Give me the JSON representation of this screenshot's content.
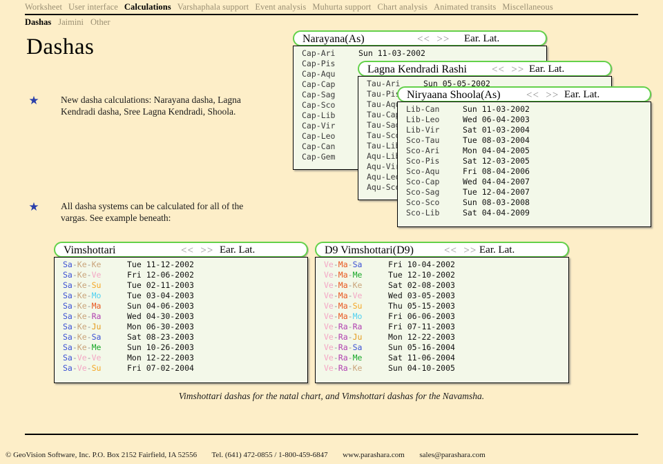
{
  "nav_primary": [
    {
      "label": "Worksheet",
      "active": false
    },
    {
      "label": "User interface",
      "active": false
    },
    {
      "label": "Calculations",
      "active": true
    },
    {
      "label": "Varshaphala support",
      "active": false
    },
    {
      "label": "Event analysis",
      "active": false
    },
    {
      "label": "Muhurta support",
      "active": false
    },
    {
      "label": "Chart analysis",
      "active": false
    },
    {
      "label": "Animated transits",
      "active": false
    },
    {
      "label": "Miscellaneous",
      "active": false
    }
  ],
  "nav_secondary": [
    {
      "label": "Dashas",
      "active": true
    },
    {
      "label": "Jaimini",
      "active": false
    },
    {
      "label": "Other",
      "active": false
    }
  ],
  "page_title": "Dashas",
  "bullets": [
    {
      "text": "New dasha calculations: Narayana dasha, Lagna Kendradi dasha, Sree Lagna Kendradi, Shoola."
    },
    {
      "text": "All dasha systems can be calculated for all of the vargas. See example beneath:"
    }
  ],
  "caption": "Vimshottari dashas for the natal chart, and Vimshottari dashas for the Navamsha.",
  "footer": {
    "copyright": "© GeoVision Software, Inc. P.O. Box 2152 Fairfield, IA 52556",
    "phone": "Tel. (641) 472-0855 / 1-800-459-6847",
    "website": "www.parashara.com",
    "email": "sales@parashara.com"
  },
  "panel_controls": {
    "prev": "<<",
    "next": ">>",
    "earlat": "Ear. Lat."
  },
  "panels": {
    "narayana": {
      "title": "Narayana(As)",
      "rows": [
        {
          "label": "Cap-Ari",
          "date": "Sun  11-03-2002"
        },
        {
          "label": "Cap-Pis",
          "date": ""
        },
        {
          "label": "Cap-Aqu",
          "date": ""
        },
        {
          "label": "Cap-Cap",
          "date": ""
        },
        {
          "label": "Cap-Sag",
          "date": ""
        },
        {
          "label": "Cap-Sco",
          "date": ""
        },
        {
          "label": "Cap-Lib",
          "date": ""
        },
        {
          "label": "Cap-Vir",
          "date": ""
        },
        {
          "label": "Cap-Leo",
          "date": ""
        },
        {
          "label": "Cap-Can",
          "date": ""
        },
        {
          "label": "Cap-Gem",
          "date": ""
        }
      ]
    },
    "lagna_kendradi": {
      "title": "Lagna Kendradi Rashi",
      "rows": [
        {
          "label": "Tau-Ari",
          "date": "Sun  05-05-2002"
        },
        {
          "label": "Tau-Pis",
          "date": ""
        },
        {
          "label": "Tau-Aqu",
          "date": ""
        },
        {
          "label": "Tau-Cap",
          "date": ""
        },
        {
          "label": "Tau-Sag",
          "date": ""
        },
        {
          "label": "Tau-Sco",
          "date": ""
        },
        {
          "label": "Tau-Lib",
          "date": ""
        },
        {
          "label": "Aqu-Lib",
          "date": ""
        },
        {
          "label": "Aqu-Vir",
          "date": ""
        },
        {
          "label": "Aqu-Leo",
          "date": ""
        },
        {
          "label": "Aqu-Sco",
          "date": ""
        }
      ]
    },
    "niryaana_shoola": {
      "title": "Niryaana Shoola(As)",
      "rows": [
        {
          "label": "Lib-Can",
          "date": "Sun  11-03-2002"
        },
        {
          "label": "Lib-Leo",
          "date": "Wed 06-04-2003"
        },
        {
          "label": "Lib-Vir",
          "date": "Sat  01-03-2004"
        },
        {
          "label": "Sco-Tau",
          "date": "Tue  08-03-2004"
        },
        {
          "label": "Sco-Ari",
          "date": "Mon 04-04-2005"
        },
        {
          "label": "Sco-Pis",
          "date": "Sat  12-03-2005"
        },
        {
          "label": "Sco-Aqu",
          "date": "Fri  08-04-2006"
        },
        {
          "label": "Sco-Cap",
          "date": "Wed 04-04-2007"
        },
        {
          "label": "Sco-Sag",
          "date": "Tue  12-04-2007"
        },
        {
          "label": "Sco-Sco",
          "date": "Sun  08-03-2008"
        },
        {
          "label": "Sco-Lib",
          "date": "Sat  04-04-2009"
        }
      ]
    },
    "vimshottari": {
      "title": "Vimshottari",
      "rows": [
        {
          "tokens": [
            "Sa",
            "Ke",
            "Ke"
          ],
          "date": "Tue  11-12-2002"
        },
        {
          "tokens": [
            "Sa",
            "Ke",
            "Ve"
          ],
          "date": "Fri  12-06-2002"
        },
        {
          "tokens": [
            "Sa",
            "Ke",
            "Su"
          ],
          "date": "Tue  02-11-2003"
        },
        {
          "tokens": [
            "Sa",
            "Ke",
            "Mo"
          ],
          "date": "Tue  03-04-2003"
        },
        {
          "tokens": [
            "Sa",
            "Ke",
            "Ma"
          ],
          "date": "Sun  04-06-2003"
        },
        {
          "tokens": [
            "Sa",
            "Ke",
            "Ra"
          ],
          "date": "Wed 04-30-2003"
        },
        {
          "tokens": [
            "Sa",
            "Ke",
            "Ju"
          ],
          "date": "Mon 06-30-2003"
        },
        {
          "tokens": [
            "Sa",
            "Ke",
            "Sa"
          ],
          "date": "Sat  08-23-2003"
        },
        {
          "tokens": [
            "Sa",
            "Ke",
            "Me"
          ],
          "date": "Sun  10-26-2003"
        },
        {
          "tokens": [
            "Sa",
            "Ve",
            "Ve"
          ],
          "date": "Mon 12-22-2003"
        },
        {
          "tokens": [
            "Sa",
            "Ve",
            "Su"
          ],
          "date": "Fri  07-02-2004"
        }
      ]
    },
    "vimshottari_d9": {
      "title": "D9  Vimshottari(D9)",
      "rows": [
        {
          "tokens": [
            "Ve",
            "Ma",
            "Sa"
          ],
          "date": "Fri  10-04-2002"
        },
        {
          "tokens": [
            "Ve",
            "Ma",
            "Me"
          ],
          "date": "Tue  12-10-2002"
        },
        {
          "tokens": [
            "Ve",
            "Ma",
            "Ke"
          ],
          "date": "Sat  02-08-2003"
        },
        {
          "tokens": [
            "Ve",
            "Ma",
            "Ve"
          ],
          "date": "Wed 03-05-2003"
        },
        {
          "tokens": [
            "Ve",
            "Ma",
            "Su"
          ],
          "date": "Thu  05-15-2003"
        },
        {
          "tokens": [
            "Ve",
            "Ma",
            "Mo"
          ],
          "date": "Fri  06-06-2003"
        },
        {
          "tokens": [
            "Ve",
            "Ra",
            "Ra"
          ],
          "date": "Fri  07-11-2003"
        },
        {
          "tokens": [
            "Ve",
            "Ra",
            "Ju"
          ],
          "date": "Mon 12-22-2003"
        },
        {
          "tokens": [
            "Ve",
            "Ra",
            "Sa"
          ],
          "date": "Sun  05-16-2004"
        },
        {
          "tokens": [
            "Ve",
            "Ra",
            "Me"
          ],
          "date": "Sat  11-06-2004"
        },
        {
          "tokens": [
            "Ve",
            "Ra",
            "Ke"
          ],
          "date": "Sun  04-10-2005"
        }
      ]
    }
  },
  "planet_colors": {
    "Sa": "#3a4fd4",
    "Ke": "#c9a37a",
    "Ve": "#f3a6c4",
    "Su": "#f5a623",
    "Mo": "#4fd0f0",
    "Ma": "#e8561f",
    "Ra": "#b03fb0",
    "Ju": "#e59a1c",
    "Me": "#1aa82a"
  },
  "theme": {
    "page_background": "#fdeec8",
    "panel_border": "#63d14a",
    "panel_list_background": "#f3f8e9",
    "nav_inactive": "#9a8f73",
    "star_color": "#2a3faa"
  }
}
